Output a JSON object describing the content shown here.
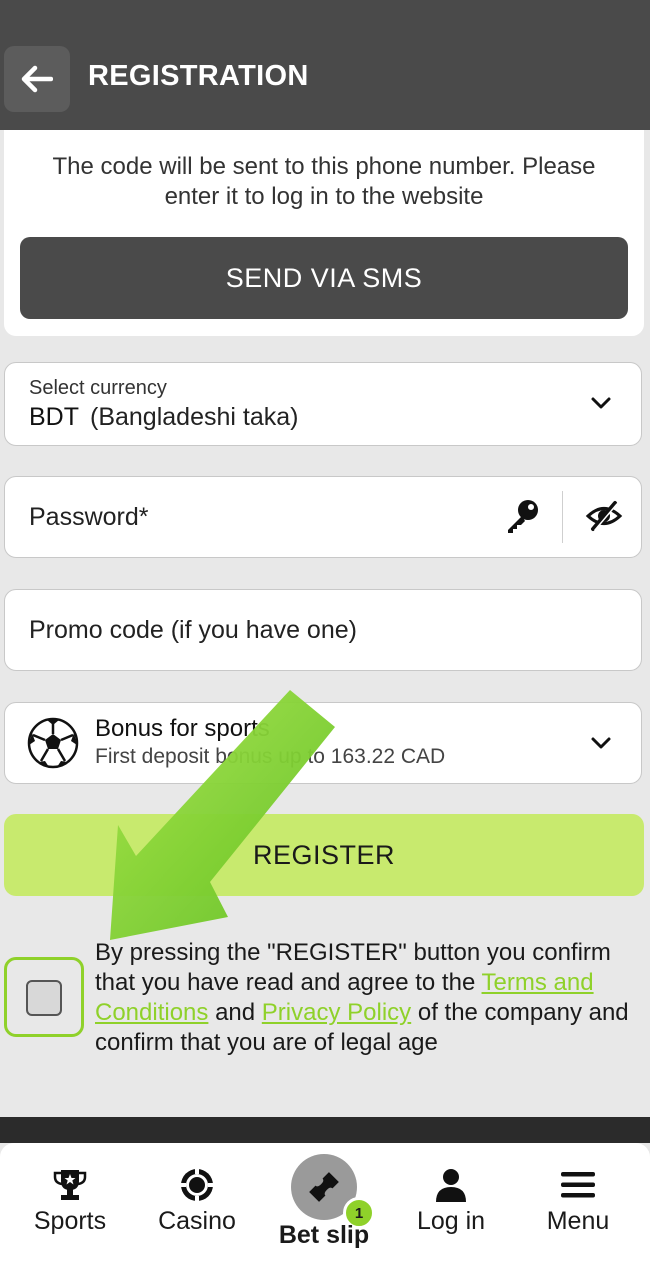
{
  "header": {
    "title": "REGISTRATION",
    "back_icon": "arrow-left-icon"
  },
  "sms": {
    "info": "The code will be sent to this phone number. Please enter it to log in to the website",
    "button": "SEND VIA SMS"
  },
  "currency": {
    "label": "Select currency",
    "code": "BDT",
    "name": "(Bangladeshi taka)"
  },
  "password": {
    "placeholder": "Password*"
  },
  "promo": {
    "placeholder": "Promo code (if you have one)"
  },
  "bonus": {
    "title": "Bonus for sports",
    "subtitle": "First deposit bonus up to 163.22 CAD"
  },
  "register": {
    "label": "REGISTER"
  },
  "consent": {
    "part1": "By pressing the \"REGISTER\" button you confirm that you have read and agree to the ",
    "terms": "Terms and Conditions",
    "and": " and ",
    "privacy": "Privacy Policy",
    "part2": " of the company and confirm that you are of legal age"
  },
  "nav": {
    "sports": "Sports",
    "casino": "Casino",
    "betslip": "Bet slip",
    "betslip_count": "1",
    "login": "Log in",
    "menu": "Menu"
  },
  "colors": {
    "accent": "#8fd12a",
    "header": "#4a4a4a",
    "register": "#c8ea6e"
  }
}
